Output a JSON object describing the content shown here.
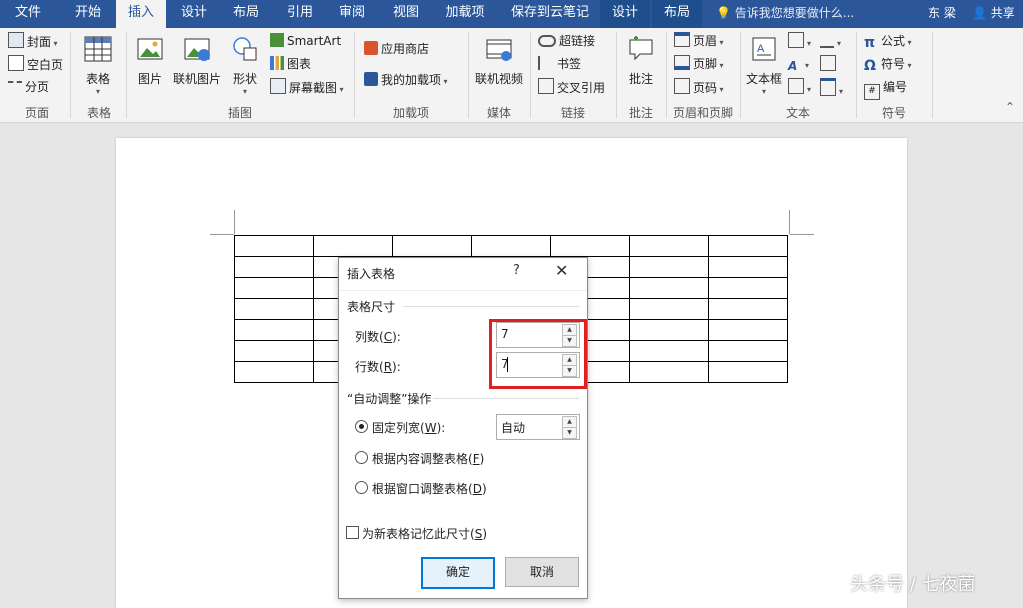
{
  "tabs": {
    "file": "文件",
    "home": "开始",
    "insert": "插入",
    "design": "设计",
    "layout": "布局",
    "references": "引用",
    "review": "审阅",
    "view": "视图",
    "addins": "加载项",
    "cloud": "保存到云笔记",
    "design2": "设计",
    "layout2": "布局"
  },
  "tell_me": "告诉我您想要做什么...",
  "user": "东 梁",
  "share": "共享",
  "ribbon": {
    "pages": {
      "cover": "封面",
      "blank": "空白页",
      "break": "分页",
      "label": "页面"
    },
    "tables": {
      "table": "表格",
      "label": "表格"
    },
    "illustrations": {
      "picture": "图片",
      "online_picture": "联机图片",
      "shapes": "形状",
      "smartart": "SmartArt",
      "chart": "图表",
      "screenshot": "屏幕截图",
      "label": "插图"
    },
    "addins": {
      "store": "应用商店",
      "my_addins": "我的加载项",
      "label": "加载项"
    },
    "media": {
      "online_video": "联机视频",
      "label": "媒体"
    },
    "links": {
      "hyperlink": "超链接",
      "bookmark": "书签",
      "cross_ref": "交叉引用",
      "label": "链接"
    },
    "comments": {
      "comment": "批注",
      "label": "批注"
    },
    "header_footer": {
      "header": "页眉",
      "footer": "页脚",
      "page_number": "页码",
      "label": "页眉和页脚"
    },
    "text": {
      "textbox": "文本框",
      "label": "文本"
    },
    "symbols": {
      "equation": "公式",
      "symbol": "符号",
      "number": "编号",
      "label": "符号"
    }
  },
  "dialog": {
    "title": "插入表格",
    "help": "?",
    "table_size": "表格尺寸",
    "columns_label": "列数(",
    "columns_key": "C",
    "columns_tail": "):",
    "columns_value": "7",
    "rows_label": "行数(",
    "rows_key": "R",
    "rows_tail": "):",
    "rows_value": "7",
    "autofit_section": "“自动调整”操作",
    "fixed_width_label": "固定列宽(",
    "fixed_width_key": "W",
    "fixed_width_tail": "):",
    "fixed_width_value": "自动",
    "autofit_content": "根据内容调整表格(",
    "autofit_content_key": "F",
    "autofit_content_tail": ")",
    "autofit_window": "根据窗口调整表格(",
    "autofit_window_key": "D",
    "autofit_window_tail": ")",
    "remember": "为新表格记忆此尺寸(",
    "remember_key": "S",
    "remember_tail": ")",
    "ok": "确定",
    "cancel": "取消"
  },
  "watermark": "头条号 / 七夜菌",
  "colors": {
    "ribbon_blue": "#2b579a",
    "highlight_red": "#e02020"
  }
}
